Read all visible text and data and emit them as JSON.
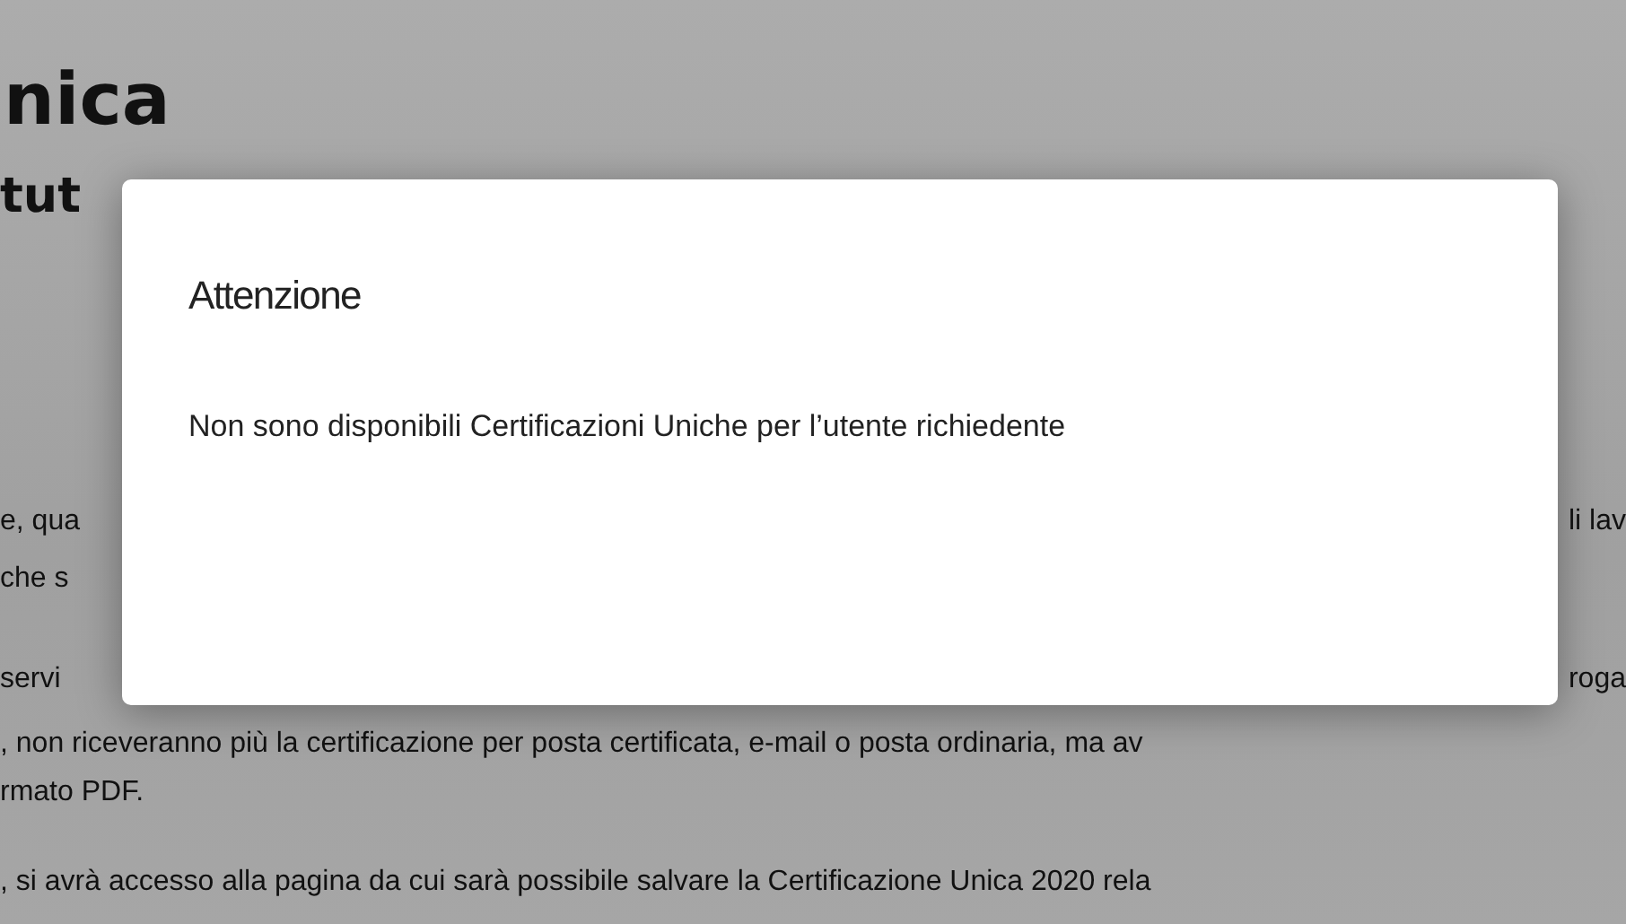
{
  "page": {
    "heading": "nica",
    "subheading": "tut",
    "lines": [
      {
        "left": "e, qua",
        "right": "li lav"
      },
      {
        "left": "che s"
      },
      {
        "left": "servi",
        "right": "roga"
      },
      {
        "left": ", non riceveranno più la certificazione per posta certificata, e-mail o posta ordinaria, ma av"
      },
      {
        "left": "rmato PDF."
      },
      {
        "left": ", si avrà accesso alla pagina da cui sarà possibile salvare la Certificazione Unica 2020 rela"
      }
    ]
  },
  "dialog": {
    "title": "Attenzione",
    "message": "Non sono disponibili Certificazioni Uniche per l’utente richiedente"
  }
}
